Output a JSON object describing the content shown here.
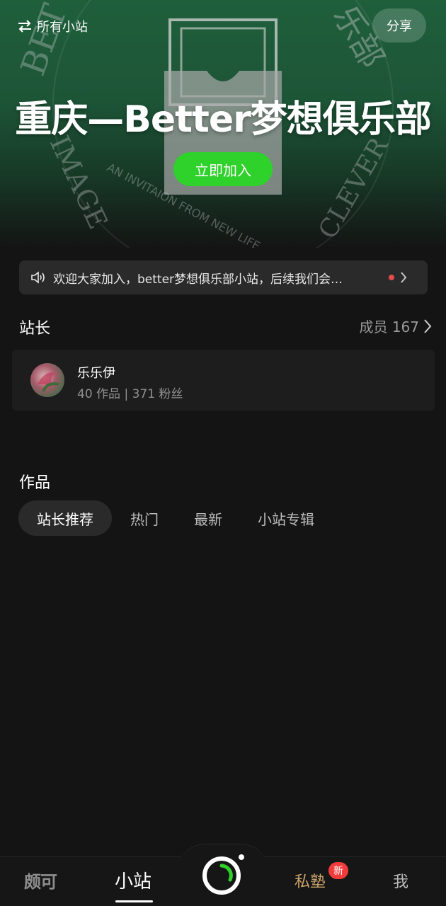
{
  "header": {
    "all_stations": "所有小站",
    "share": "分享",
    "title": "重庆—Better梦想俱乐部",
    "join": "立即加入",
    "art_text_left": "BET",
    "art_text_right": "乐部",
    "art_arc_text": "AN INVITAION FROM NEW LIFE",
    "art_image": "IMAGE",
    "art_clever": "CLEVER"
  },
  "notice": {
    "text": "欢迎大家加入，better梦想俱乐部小站，后续我们会…"
  },
  "owner_section": {
    "label": "站长",
    "members": "成员 167",
    "name": "乐乐伊",
    "stats": "40 作品 | 371 粉丝"
  },
  "works": {
    "label": "作品",
    "tabs": [
      "站长推荐",
      "热门",
      "最新",
      "小站专辑"
    ]
  },
  "bottom_nav": {
    "logo": "颇可",
    "station": "小站",
    "private": "私塾",
    "new_badge": "新",
    "me": "我"
  },
  "colors": {
    "accent_green": "#2fd12b",
    "badge_red": "#f23b3b",
    "private_gold": "#c9a36a",
    "background": "#141414"
  },
  "icons": [
    "swap-arrows-icon",
    "speaker-icon",
    "chevron-right-icon",
    "camera-ring-icon"
  ]
}
